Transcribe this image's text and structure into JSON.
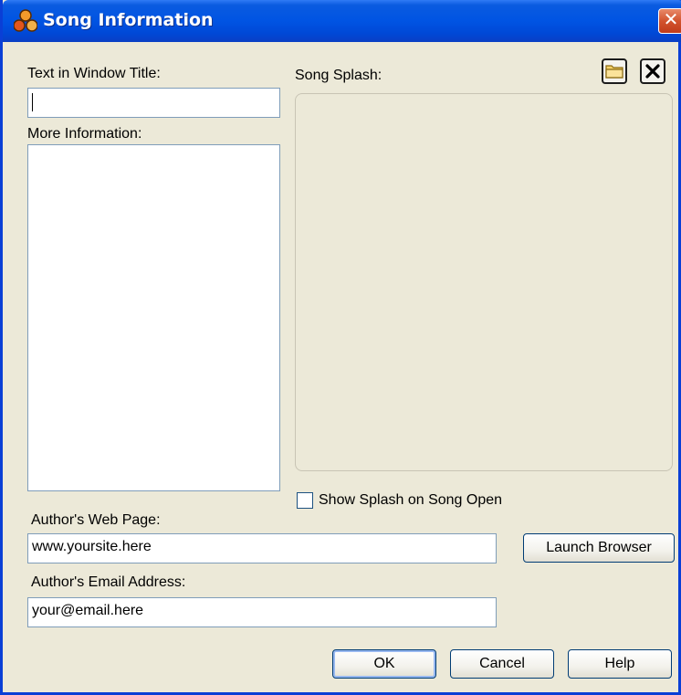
{
  "window": {
    "title": "Song Information",
    "close_glyph": "✕"
  },
  "icons": {
    "app": "app-logo-icon",
    "open_folder": "folder-icon",
    "clear_splash": "clear-x-icon"
  },
  "fields": {
    "window_title_label": "Text in Window Title:",
    "window_title_value": "",
    "more_info_label": "More Information:",
    "more_info_value": "",
    "song_splash_label": "Song Splash:",
    "show_splash_label": "Show Splash on Song Open",
    "show_splash_checked": false,
    "web_page_label": "Author's Web Page:",
    "web_page_value": "www.yoursite.here",
    "email_label": "Author's Email Address:",
    "email_value": "your@email.here"
  },
  "buttons": {
    "launch_browser": "Launch Browser",
    "ok": "OK",
    "cancel": "Cancel",
    "help": "Help"
  },
  "colors": {
    "titlebar_blue": "#0054e3",
    "close_red": "#d2532e",
    "dialog_bg": "#ece9d8"
  }
}
